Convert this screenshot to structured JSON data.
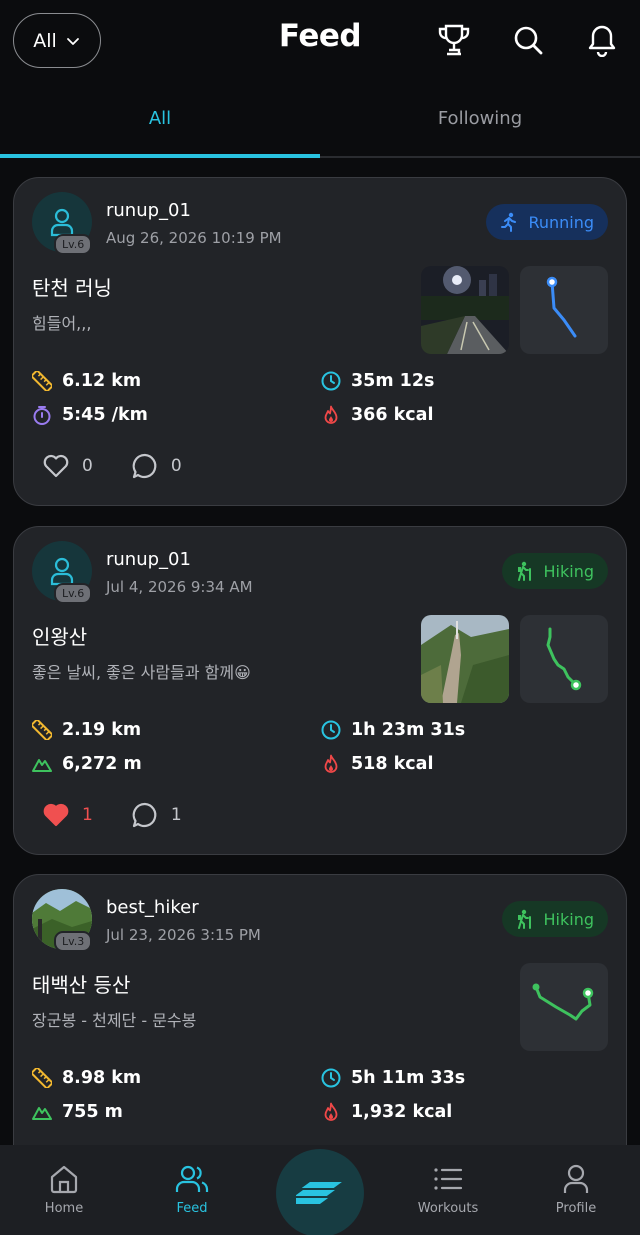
{
  "header": {
    "filter_label": "All",
    "title": "Feed",
    "icons": [
      "trophy-icon",
      "search-icon",
      "bell-icon"
    ]
  },
  "tabs": [
    {
      "label": "All",
      "active": true
    },
    {
      "label": "Following",
      "active": false
    }
  ],
  "posts": [
    {
      "username": "runup_01",
      "level": "Lv.6",
      "date": "Aug 26, 2026 10:19 PM",
      "activity": "Running",
      "title": "탄천 러닝",
      "text": "힘들어,,,",
      "stats": {
        "distance": "6.12 km",
        "duration": "35m 12s",
        "pace": "5:45 /km",
        "calories": "366 kcal"
      },
      "likes": "0",
      "comments": "0",
      "liked": false
    },
    {
      "username": "runup_01",
      "level": "Lv.6",
      "date": "Jul 4, 2026 9:34 AM",
      "activity": "Hiking",
      "title": "인왕산",
      "text": "좋은 날씨,  좋은 사람들과 함께😀",
      "stats": {
        "distance": "2.19 km",
        "duration": "1h 23m 31s",
        "elevation": "6,272 m",
        "calories": "518 kcal"
      },
      "likes": "1",
      "comments": "1",
      "liked": true
    },
    {
      "username": "best_hiker",
      "level": "Lv.3",
      "date": "Jul 23, 2026 3:15 PM",
      "activity": "Hiking",
      "title": "태백산 등산",
      "text": "장군봉 - 천제단 - 문수봉",
      "stats": {
        "distance": "8.98 km",
        "duration": "5h 11m 33s",
        "elevation": "755 m",
        "calories": "1,932 kcal"
      }
    }
  ],
  "nav": [
    {
      "label": "Home",
      "icon": "home-icon"
    },
    {
      "label": "Feed",
      "icon": "people-icon",
      "active": true
    },
    {
      "label": "",
      "icon": "start-workout-icon"
    },
    {
      "label": "Workouts",
      "icon": "list-icon"
    },
    {
      "label": "Profile",
      "icon": "profile-icon"
    }
  ],
  "colors": {
    "accent": "#29c3e0",
    "running": "#3b8cf7",
    "hiking": "#3ec25e",
    "like": "#f05050"
  }
}
